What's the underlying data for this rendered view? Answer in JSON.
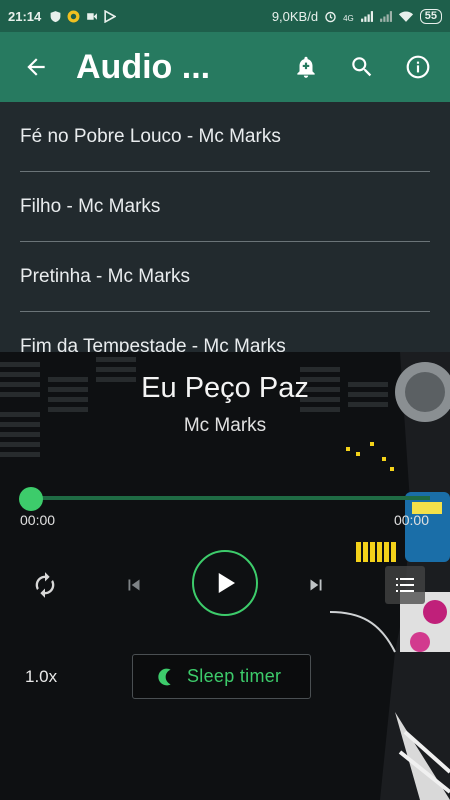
{
  "status_bar": {
    "time": "21:14",
    "net_speed": "9,0KB/d",
    "signal_label": "4G",
    "battery": "55"
  },
  "toolbar": {
    "title": "Audio ...",
    "icons": [
      "back-arrow-icon",
      "bell-plus-icon",
      "search-icon",
      "info-icon"
    ]
  },
  "playlist": {
    "items": [
      {
        "label": "Fé no Pobre Louco - Mc Marks"
      },
      {
        "label": "Filho - Mc Marks"
      },
      {
        "label": "Pretinha - Mc Marks"
      },
      {
        "label": "Fim da Tempestade - Mc Marks"
      }
    ]
  },
  "player": {
    "title": "Eu Peço Paz",
    "artist": "Mc Marks",
    "elapsed": "00:00",
    "duration": "00:00",
    "progress": 0,
    "speed": "1.0x",
    "sleep_timer_label": "Sleep timer",
    "accent_color": "#3dcc6b",
    "toolbar_color": "#277a60"
  }
}
